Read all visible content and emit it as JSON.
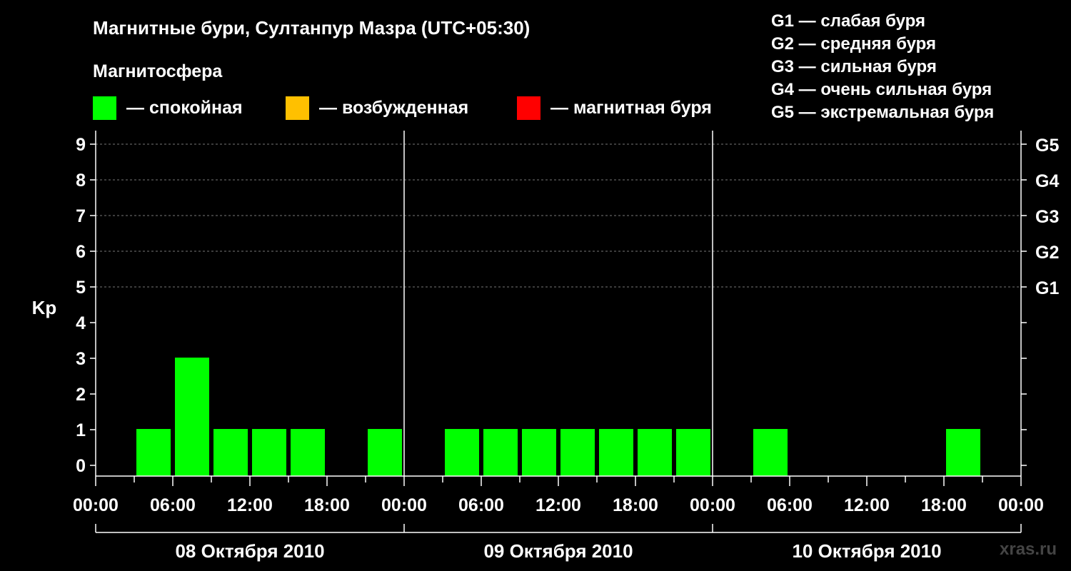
{
  "header": {
    "title": "Магнитные бури, Султанпур Мазра (UTC+05:30)",
    "subtitle": "Магнитосфера"
  },
  "legend": {
    "items": [
      {
        "label": "— спокойная",
        "color": "#00ff00"
      },
      {
        "label": "— возбужденная",
        "color": "#ffc000"
      },
      {
        "label": "— магнитная буря",
        "color": "#ff0000"
      }
    ]
  },
  "g_legend": [
    "G1 — слабая буря",
    "G2 — средняя буря",
    "G3 — сильная буря",
    "G4 — очень сильная буря",
    "G5 — экстремальная буря"
  ],
  "watermark": "xras.ru",
  "chart_data": {
    "type": "bar",
    "ylabel": "Kp",
    "ylim": [
      0,
      9
    ],
    "y_ticks": [
      "0",
      "1",
      "2",
      "3",
      "4",
      "5",
      "6",
      "7",
      "8",
      "9"
    ],
    "right_ticks": [
      {
        "kp": 5,
        "label": "G1"
      },
      {
        "kp": 6,
        "label": "G2"
      },
      {
        "kp": 7,
        "label": "G3"
      },
      {
        "kp": 8,
        "label": "G4"
      },
      {
        "kp": 9,
        "label": "G5"
      }
    ],
    "x_tick_labels": [
      "00:00",
      "06:00",
      "12:00",
      "18:00",
      "00:00",
      "06:00",
      "12:00",
      "18:00",
      "00:00",
      "06:00",
      "12:00",
      "18:00",
      "00:00"
    ],
    "days": [
      "08 Октября 2010",
      "09 Октября 2010",
      "10 Октября 2010"
    ],
    "interval_hours": 3,
    "grid": true,
    "series": [
      {
        "values": [
          0,
          1,
          3,
          1,
          1,
          1,
          0,
          1,
          0,
          1,
          1,
          1,
          1,
          1,
          1,
          1,
          0,
          1,
          0,
          0,
          0,
          0,
          1,
          0
        ],
        "color": "#00ff00"
      }
    ]
  }
}
